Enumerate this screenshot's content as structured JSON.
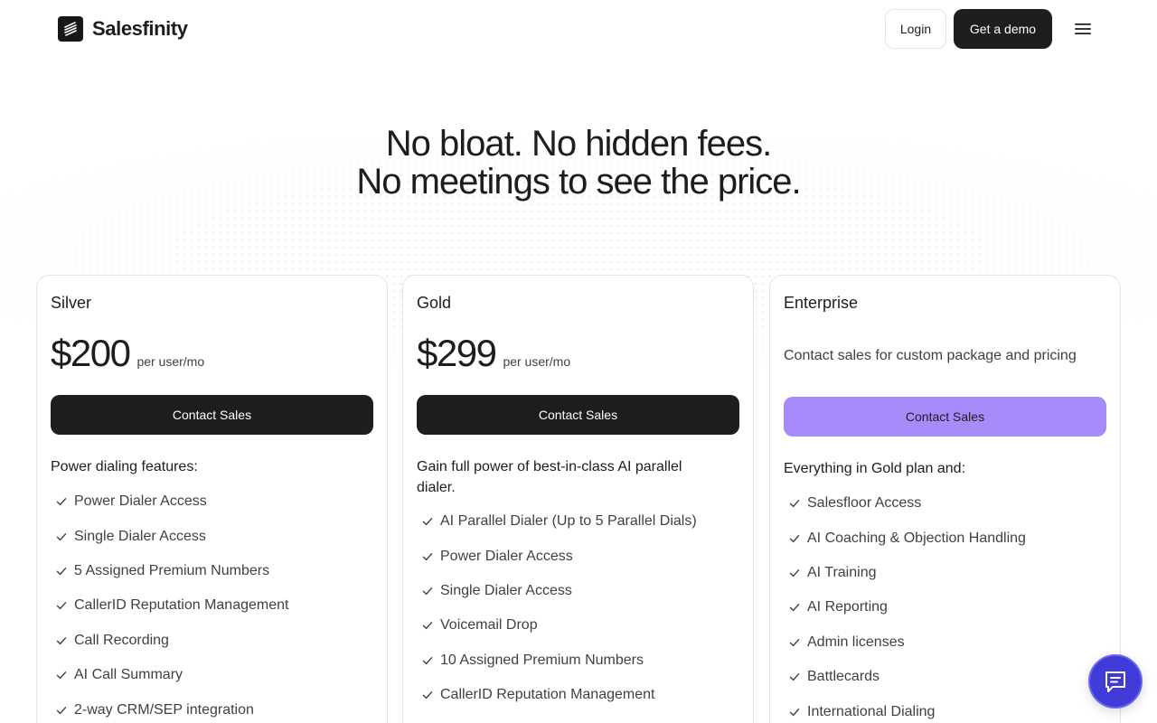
{
  "brand": {
    "name": "Salesfinity"
  },
  "nav": {
    "login": "Login",
    "demo": "Get a demo"
  },
  "hero": {
    "line1": "No bloat. No hidden fees.",
    "line2": "No meetings to see the price."
  },
  "plans": [
    {
      "name": "Silver",
      "price": "$200",
      "per": "per user/mo",
      "cta": "Contact Sales",
      "intro": "Power dialing features:",
      "features": [
        "Power Dialer Access",
        "Single Dialer Access",
        "5 Assigned Premium Numbers",
        "CallerID Reputation Management",
        "Call Recording",
        "AI Call Summary",
        "2-way CRM/SEP integration"
      ]
    },
    {
      "name": "Gold",
      "price": "$299",
      "per": "per user/mo",
      "cta": "Contact Sales",
      "intro": "Gain full power of best-in-class AI parallel dialer.",
      "features": [
        "AI Parallel Dialer (Up to 5 Parallel Dials)",
        "Power Dialer Access",
        "Single Dialer Access",
        "Voicemail Drop",
        "10 Assigned Premium Numbers",
        "CallerID Reputation Management"
      ]
    },
    {
      "name": "Enterprise",
      "contact_text": "Contact sales for custom package and pricing",
      "cta": "Contact Sales",
      "intro": "Everything in Gold plan and:",
      "features": [
        "Salesfloor Access",
        "AI Coaching & Objection Handling",
        "AI Training",
        "AI Reporting",
        "Admin licenses",
        "Battlecards",
        "International Dialing"
      ]
    }
  ],
  "colors": {
    "dark": "#1e1e20",
    "enterprise_cta": "#a78bfa",
    "chat": "#3f3ad8"
  },
  "icons": {
    "logo": "salesfinity-logo-icon",
    "menu": "hamburger-menu-icon",
    "check": "check-icon",
    "chat": "chat-bubble-icon"
  }
}
